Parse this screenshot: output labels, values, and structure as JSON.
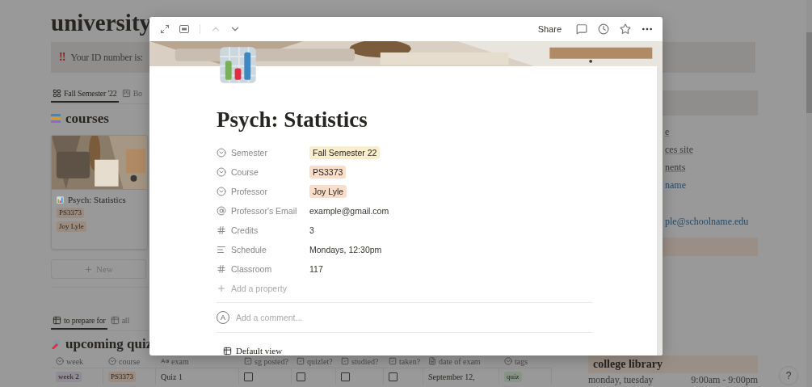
{
  "page": {
    "title": "university",
    "callout": {
      "icon": "‼",
      "text": "Your ID number is:"
    },
    "views": [
      {
        "label": "Fall Semester '22",
        "kind": "gallery",
        "selected": true
      },
      {
        "label": "Bo",
        "kind": "board",
        "selected": false
      }
    ],
    "courses": {
      "title": "courses",
      "cards": [
        {
          "title": "Psych: Statistics",
          "tags": [
            {
              "label": "PS3373",
              "color": "#9c8b7f"
            },
            {
              "label": "Joy Lyle",
              "color": "#9c8b7f"
            }
          ]
        }
      ],
      "new_button": "New"
    },
    "quiz_views": [
      {
        "label": "to prepare for",
        "selected": true
      },
      {
        "label": "all",
        "selected": false
      }
    ],
    "quizzes": {
      "title": "upcoming quiz",
      "columns": [
        {
          "label": "week",
          "kind": "select"
        },
        {
          "label": "course",
          "kind": "select"
        },
        {
          "label": "exam",
          "kind": "title"
        },
        {
          "label": "sg posted?",
          "kind": "checkbox"
        },
        {
          "label": "quizlet?",
          "kind": "checkbox"
        },
        {
          "label": "studied?",
          "kind": "checkbox"
        },
        {
          "label": "taken?",
          "kind": "checkbox"
        },
        {
          "label": "date of exam",
          "kind": "text"
        },
        {
          "label": "tags",
          "kind": "select"
        }
      ],
      "rows": [
        {
          "cells": [
            {
              "kind": "tag",
              "text": "week 2",
              "color": "#918b95"
            },
            {
              "kind": "tag",
              "text": "PS3373",
              "color": "#9c8b7f"
            },
            {
              "kind": "text",
              "text": "Quiz 1"
            },
            {
              "kind": "checkbox",
              "checked": false
            },
            {
              "kind": "checkbox",
              "checked": false
            },
            {
              "kind": "checkbox",
              "checked": false
            },
            {
              "kind": "checkbox",
              "checked": false
            },
            {
              "kind": "text",
              "text": "September 12,"
            },
            {
              "kind": "tag",
              "text": "quiz",
              "color": "#899489"
            }
          ]
        }
      ]
    }
  },
  "sidebar": {
    "links": [
      {
        "text": "e",
        "kind": "page"
      },
      {
        "text": "ces site",
        "kind": "page"
      },
      {
        "text": "nents",
        "kind": "page"
      },
      {
        "text": "name",
        "kind": "url"
      }
    ],
    "email": "ple@schoolname.edu",
    "library": {
      "title": "college library",
      "hours": [
        {
          "days": "monday, tuesday",
          "time": "9:00am - 9:00pm"
        }
      ]
    }
  },
  "help": "?",
  "modal": {
    "toolbar": {
      "share": "Share",
      "previous_disabled": true
    },
    "title": "Psych: Statistics",
    "properties": [
      {
        "kind": "select",
        "label": "Semester",
        "value": "Fall Semester 22",
        "color": "#fbeecc"
      },
      {
        "kind": "select",
        "label": "Course",
        "value": "PS3373",
        "color": "#fadec9"
      },
      {
        "kind": "select",
        "label": "Professor",
        "value": "Joy Lyle",
        "color": "#fadec9"
      },
      {
        "kind": "email",
        "label": "Professor's Email",
        "value": "example@gmail.com"
      },
      {
        "kind": "number",
        "label": "Credits",
        "value": "3"
      },
      {
        "kind": "text",
        "label": "Schedule",
        "value": "Mondays, 12:30pm"
      },
      {
        "kind": "number",
        "label": "Classroom",
        "value": "117"
      }
    ],
    "add_property": "Add a property",
    "comment": {
      "avatar": "A",
      "placeholder": "Add a comment..."
    },
    "view": "Default view"
  }
}
